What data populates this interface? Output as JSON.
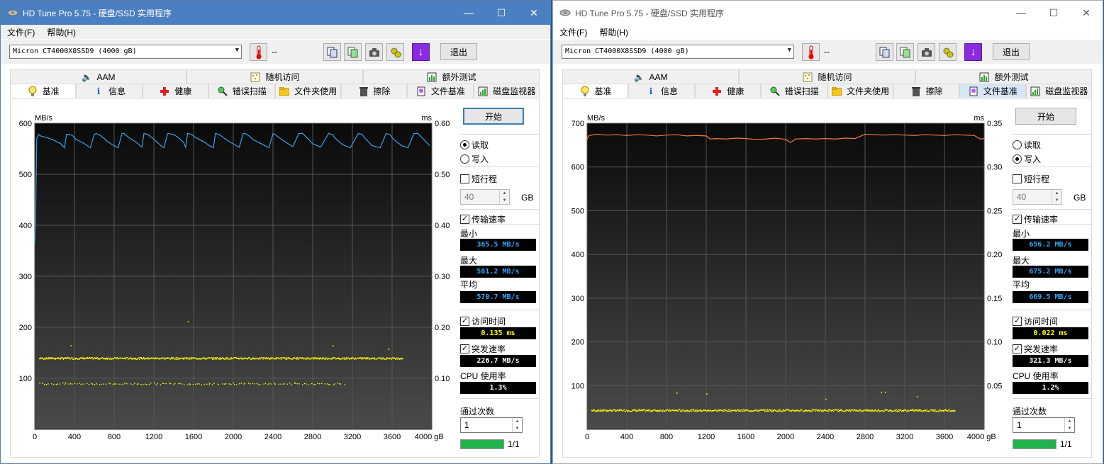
{
  "windows": [
    {
      "title": "HD Tune Pro 5.75 - 硬盘/SSD 实用程序",
      "menu": [
        "文件(F)",
        "帮助(H)"
      ],
      "drive": "Micron  CT4000X8SSD9 (4000 gB)",
      "temperature": "--",
      "exit_label": "退出",
      "tabs_top": [
        "AAM",
        "随机访问",
        "额外测试"
      ],
      "tabs_bottom": [
        "基准",
        "信息",
        "健康",
        "错误扫描",
        "文件夹使用",
        "擦除",
        "文件基准",
        "磁盘监视器"
      ],
      "active_tab": "基准",
      "start_label": "开始",
      "mode_read": "读取",
      "mode_write": "写入",
      "selected_mode": "read",
      "short_stroke_label": "短行程",
      "short_stroke_checked": false,
      "short_stroke_value": "40",
      "gb_label": "GB",
      "transfer_rate_label": "传输速率",
      "transfer_rate_checked": true,
      "min_label": "最小",
      "min_value": "365.5 MB/s",
      "max_label": "最大",
      "max_value": "581.2 MB/s",
      "avg_label": "平均",
      "avg_value": "570.7 MB/s",
      "access_time_label": "访问时间",
      "access_time_checked": true,
      "access_time_value": "0.135 ms",
      "burst_label": "突发速率",
      "burst_checked": true,
      "burst_value": "226.7 MB/s",
      "cpu_label": "CPU 使用率",
      "cpu_value": "1.3%",
      "passes_label": "通过次数",
      "passes_value": "1",
      "progress_text": "1/1",
      "progress_fraction": 1.0
    },
    {
      "title": "HD Tune Pro 5.75 - 硬盘/SSD 实用程序",
      "menu": [
        "文件(F)",
        "帮助(H)"
      ],
      "drive": "Micron  CT4000X8SSD9 (4000 gB)",
      "temperature": "--",
      "exit_label": "退出",
      "tabs_top": [
        "AAM",
        "随机访问",
        "额外测试"
      ],
      "tabs_bottom": [
        "基准",
        "信息",
        "健康",
        "错误扫描",
        "文件夹使用",
        "擦除",
        "文件基准",
        "磁盘监视器"
      ],
      "active_tab": "基准",
      "start_label": "开始",
      "mode_read": "读取",
      "mode_write": "写入",
      "selected_mode": "write",
      "short_stroke_label": "短行程",
      "short_stroke_checked": false,
      "short_stroke_value": "40",
      "gb_label": "GB",
      "transfer_rate_label": "传输速率",
      "transfer_rate_checked": true,
      "min_label": "最小",
      "min_value": "656.2 MB/s",
      "max_label": "最大",
      "max_value": "675.2 MB/s",
      "avg_label": "平均",
      "avg_value": "669.5 MB/s",
      "access_time_label": "访问时间",
      "access_time_checked": true,
      "access_time_value": "0.022 ms",
      "burst_label": "突发速率",
      "burst_checked": true,
      "burst_value": "321.3 MB/s",
      "cpu_label": "CPU 使用率",
      "cpu_value": "1.2%",
      "passes_label": "通过次数",
      "passes_value": "1",
      "progress_text": "1/1",
      "progress_fraction": 1.0
    }
  ],
  "chart_data": [
    {
      "type": "line",
      "left_axis_unit": "MB/s",
      "right_axis_unit": "ms",
      "x_unit": "gB",
      "x_ticks": [
        "0",
        "400",
        "800",
        "1200",
        "1600",
        "2000",
        "2400",
        "2800",
        "3200",
        "3600",
        "4000"
      ],
      "y_left_ticks": [
        "600",
        "500",
        "400",
        "300",
        "200",
        "100"
      ],
      "y_right_ticks": [
        "0.60",
        "0.50",
        "0.40",
        "0.30",
        "0.20",
        "0.10"
      ],
      "xlim": [
        0,
        4000
      ],
      "ylim_left": [
        0,
        600
      ],
      "ylim_right": [
        0,
        0.6
      ],
      "series": [
        {
          "color": "#3aa0e8",
          "axis": "left",
          "x": [
            0,
            10,
            20,
            40,
            60,
            100,
            150,
            200,
            260,
            300,
            320,
            350,
            380,
            400,
            420,
            500,
            560,
            600,
            620,
            660,
            700,
            720,
            780,
            840,
            880,
            900,
            920,
            980,
            1040,
            1080,
            1100,
            1140,
            1180,
            1220,
            1260,
            1300,
            1340,
            1400,
            1460,
            1500,
            1520,
            1540,
            1580,
            1620,
            1700,
            1760,
            1800,
            1820,
            1860,
            1900,
            1960,
            2060,
            2100,
            2120,
            2160,
            2200,
            2280,
            2360,
            2400,
            2420,
            2460,
            2520,
            2600,
            2660,
            2700,
            2720,
            2760,
            2800,
            2880,
            2960,
            3000,
            3020,
            3060,
            3100,
            3180,
            3260,
            3300,
            3320,
            3360,
            3400,
            3480,
            3540,
            3580,
            3600,
            3640,
            3700,
            3760,
            3820,
            3860,
            3880,
            3920,
            3980
          ],
          "values": [
            365,
            430,
            570,
            578,
            575,
            573,
            570,
            566,
            560,
            552,
            578,
            578,
            576,
            572,
            568,
            560,
            552,
            578,
            580,
            576,
            570,
            566,
            558,
            552,
            580,
            580,
            576,
            568,
            560,
            553,
            580,
            578,
            572,
            565,
            558,
            552,
            580,
            578,
            570,
            562,
            553,
            580,
            578,
            572,
            564,
            556,
            552,
            580,
            578,
            572,
            564,
            553,
            580,
            580,
            575,
            568,
            560,
            552,
            580,
            578,
            572,
            564,
            554,
            580,
            580,
            576,
            568,
            560,
            553,
            580,
            578,
            572,
            565,
            558,
            552,
            580,
            578,
            572,
            564,
            556,
            552,
            580,
            578,
            572,
            564,
            556,
            552,
            580,
            580,
            576,
            568,
            556
          ]
        },
        {
          "color": "#ffff00",
          "axis": "right",
          "style": "points",
          "bands_ms": [
            0.14,
            0.09
          ],
          "band_x_end": [
            3700,
            3100
          ],
          "outliers_x": [
            360,
            1540,
            3000,
            3560
          ],
          "outliers_ms": [
            0.165,
            0.212,
            0.165,
            0.158
          ]
        }
      ]
    },
    {
      "type": "line",
      "left_axis_unit": "MB/s",
      "right_axis_unit": "ms",
      "x_unit": "gB",
      "x_ticks": [
        "0",
        "400",
        "800",
        "1200",
        "1600",
        "2000",
        "2400",
        "2800",
        "3200",
        "3600",
        "4000"
      ],
      "y_left_ticks": [
        "700",
        "600",
        "500",
        "400",
        "300",
        "200",
        "100"
      ],
      "y_right_ticks": [
        "0.35",
        "0.30",
        "0.25",
        "0.20",
        "0.15",
        "0.10",
        "0.05"
      ],
      "xlim": [
        0,
        4000
      ],
      "ylim_left": [
        0,
        700
      ],
      "ylim_right": [
        0,
        0.35
      ],
      "series": [
        {
          "color": "#f07a3a",
          "axis": "left",
          "x": [
            0,
            20,
            100,
            200,
            300,
            400,
            500,
            600,
            700,
            800,
            900,
            1000,
            1100,
            1200,
            1240,
            1300,
            1400,
            1500,
            1600,
            1700,
            1800,
            1900,
            2000,
            2050,
            2100,
            2200,
            2300,
            2400,
            2500,
            2600,
            2700,
            2800,
            2900,
            3000,
            3100,
            3200,
            3300,
            3400,
            3500,
            3600,
            3700,
            3800,
            3900,
            3960,
            4000
          ],
          "values": [
            664,
            672,
            675,
            673,
            674,
            672,
            674,
            673,
            671,
            673,
            674,
            671,
            672,
            671,
            664,
            665,
            664,
            666,
            665,
            663,
            664,
            666,
            663,
            656,
            664,
            665,
            664,
            665,
            664,
            666,
            665,
            675,
            674,
            673,
            674,
            673,
            672,
            674,
            673,
            672,
            674,
            673,
            672,
            664,
            665
          ]
        },
        {
          "color": "#ffff00",
          "axis": "right",
          "style": "points",
          "bands_ms": [
            0.022
          ],
          "band_x_end": [
            3700
          ],
          "outliers_x": [
            900,
            1200,
            2960,
            3000,
            3320,
            2400
          ],
          "outliers_ms": [
            0.042,
            0.041,
            0.043,
            0.043,
            0.038,
            0.035
          ]
        }
      ]
    }
  ]
}
